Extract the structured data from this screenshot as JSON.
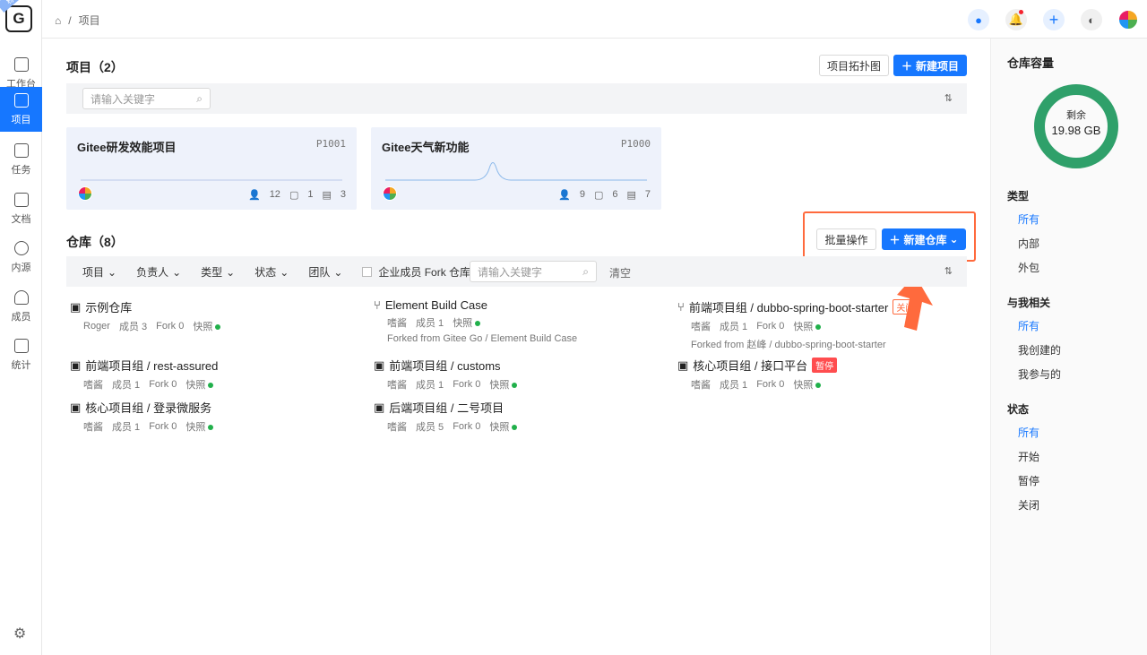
{
  "sidebar": {
    "logo": "G",
    "badge": "标准",
    "items": [
      "工作台",
      "项目",
      "任务",
      "文档",
      "内源",
      "成员",
      "统计"
    ]
  },
  "breadcrumb": {
    "home": "⌂",
    "sep": "/",
    "current": "项目"
  },
  "projects": {
    "title": "项目（2）",
    "topo_btn": "项目拓扑图",
    "new_btn": "新建项目",
    "search_placeholder": "请输入关键字",
    "cards": [
      {
        "name": "Gitee研发效能项目",
        "code": "P1001",
        "members": "12",
        "repos": "1",
        "tasks": "3"
      },
      {
        "name": "Gitee天气新功能",
        "code": "P1000",
        "members": "9",
        "repos": "6",
        "tasks": "7"
      }
    ]
  },
  "repos": {
    "title": "仓库（8）",
    "batch_btn": "批量操作",
    "new_btn": "新建仓库",
    "filters": [
      "项目",
      "负责人",
      "类型",
      "状态",
      "团队"
    ],
    "fork_label": "企业成员 Fork 仓库",
    "search_placeholder": "请输入关键字",
    "clear": "清空",
    "items": [
      {
        "name": "示例仓库",
        "owner": "Roger",
        "members": "成员 3",
        "fork": "Fork 0",
        "snap": "快照"
      },
      {
        "name": "Element Build Case",
        "owner": "嗜酱",
        "members": "成员 1",
        "fork": "",
        "snap": "快照",
        "from": "Forked from Gitee Go / Element Build Case"
      },
      {
        "name": "前端项目组 / dubbo-spring-boot-starter",
        "owner": "嗜酱",
        "members": "成员 1",
        "fork": "Fork 0",
        "snap": "快照",
        "from": "Forked from 赵峰 / dubbo-spring-boot-starter",
        "tag": "关闭"
      },
      {
        "name": "前端项目组 / rest-assured",
        "owner": "嗜酱",
        "members": "成员 1",
        "fork": "Fork 0",
        "snap": "快照"
      },
      {
        "name": "前端项目组 / customs",
        "owner": "嗜酱",
        "members": "成员 1",
        "fork": "Fork 0",
        "snap": "快照"
      },
      {
        "name": "核心项目组 / 接口平台",
        "owner": "嗜酱",
        "members": "成员 1",
        "fork": "Fork 0",
        "snap": "快照",
        "tag": "暂停"
      },
      {
        "name": "核心项目组 / 登录微服务",
        "owner": "嗜酱",
        "members": "成员 1",
        "fork": "Fork 0",
        "snap": "快照"
      },
      {
        "name": "后端项目组 / 二号项目",
        "owner": "嗜酱",
        "members": "成员 5",
        "fork": "Fork 0",
        "snap": "快照"
      }
    ]
  },
  "right": {
    "title": "仓库容量",
    "remain_label": "剩余",
    "remain": "19.98 GB",
    "remain_fraction": 1.0,
    "type_title": "类型",
    "types": [
      "所有",
      "内部",
      "外包"
    ],
    "rel_title": "与我相关",
    "rels": [
      "所有",
      "我创建的",
      "我参与的"
    ],
    "status_title": "状态",
    "statuses": [
      "所有",
      "开始",
      "暂停",
      "关闭"
    ]
  },
  "colors": {
    "accent": "#1677ff",
    "highlight": "#ff6a3d",
    "ring": "#2fa06a"
  }
}
